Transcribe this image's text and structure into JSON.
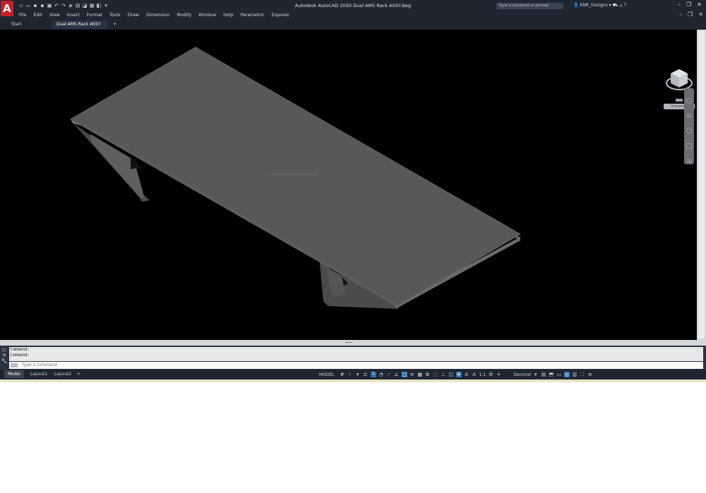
{
  "window": {
    "title": "Autodesk AutoCAD 2020   Dual AMS Rack ASSY.dwg",
    "search_placeholder": "Type a keyword or phrase",
    "user": "KNR_Designs"
  },
  "menu": [
    "File",
    "Edit",
    "View",
    "Insert",
    "Format",
    "Tools",
    "Draw",
    "Dimension",
    "Modify",
    "Window",
    "Help",
    "Parametric",
    "Express"
  ],
  "tabs": {
    "start": "Start",
    "doc": "Dual AMS Rack ASSY",
    "close": "×",
    "add": "+"
  },
  "viewcube": {
    "label": "Unnamed"
  },
  "command": {
    "history": [
      "Command:",
      "Command:"
    ],
    "placeholder": "Type a command"
  },
  "status": {
    "model": "MODEL",
    "units": "Decimal",
    "scale": "1:1",
    "layouts": [
      "Model",
      "Layout1",
      "Layout2"
    ],
    "add": "+"
  },
  "colors": {
    "app_bg": "#1f2632",
    "viewport_bg": "#000000",
    "model_fill": "#585858",
    "accent": "#2f6fb0"
  }
}
